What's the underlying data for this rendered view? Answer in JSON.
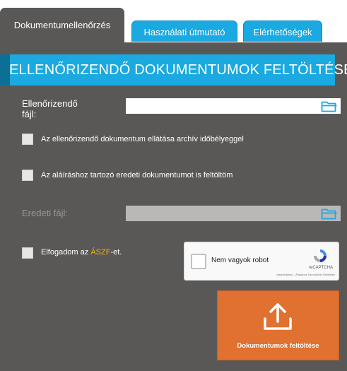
{
  "tabs": [
    {
      "label": "Dokumentumellenőrzés",
      "active": true
    },
    {
      "label": "Használati útmutató",
      "active": false
    },
    {
      "label": "Elérhetőségek",
      "active": false
    }
  ],
  "banner": {
    "title": "ELLENŐRIZENDŐ DOKUMENTUMOK FELTÖLTÉSE"
  },
  "form": {
    "file_label_line1": "Ellenőrizendő",
    "file_label_line2": "fájl:",
    "file_value": "",
    "archive_timestamp_label": "Az ellenőrizendő dokumentum ellátása archív időbélyeggel",
    "original_upload_label": "Az aláíráshoz tartozó eredeti dokumentumot is feltöltöm",
    "original_file_label": "Eredeti fájl:",
    "original_file_value": "",
    "accept_prefix": "Elfogadom az ",
    "accept_link": "ÁSZF",
    "accept_suffix": "-et."
  },
  "recaptcha": {
    "label": "Nem vagyok robot",
    "brand": "reCAPTCHA",
    "links": "Adatvédelem - Általános Szerződési Feltételek"
  },
  "upload_button": {
    "label": "Dokumentumok feltöltése",
    "icon": "upload-icon"
  },
  "colors": {
    "panel": "#595856",
    "accent_blue": "#1aa9e0",
    "upload_orange": "#e07130",
    "link": "#f2b21c"
  }
}
